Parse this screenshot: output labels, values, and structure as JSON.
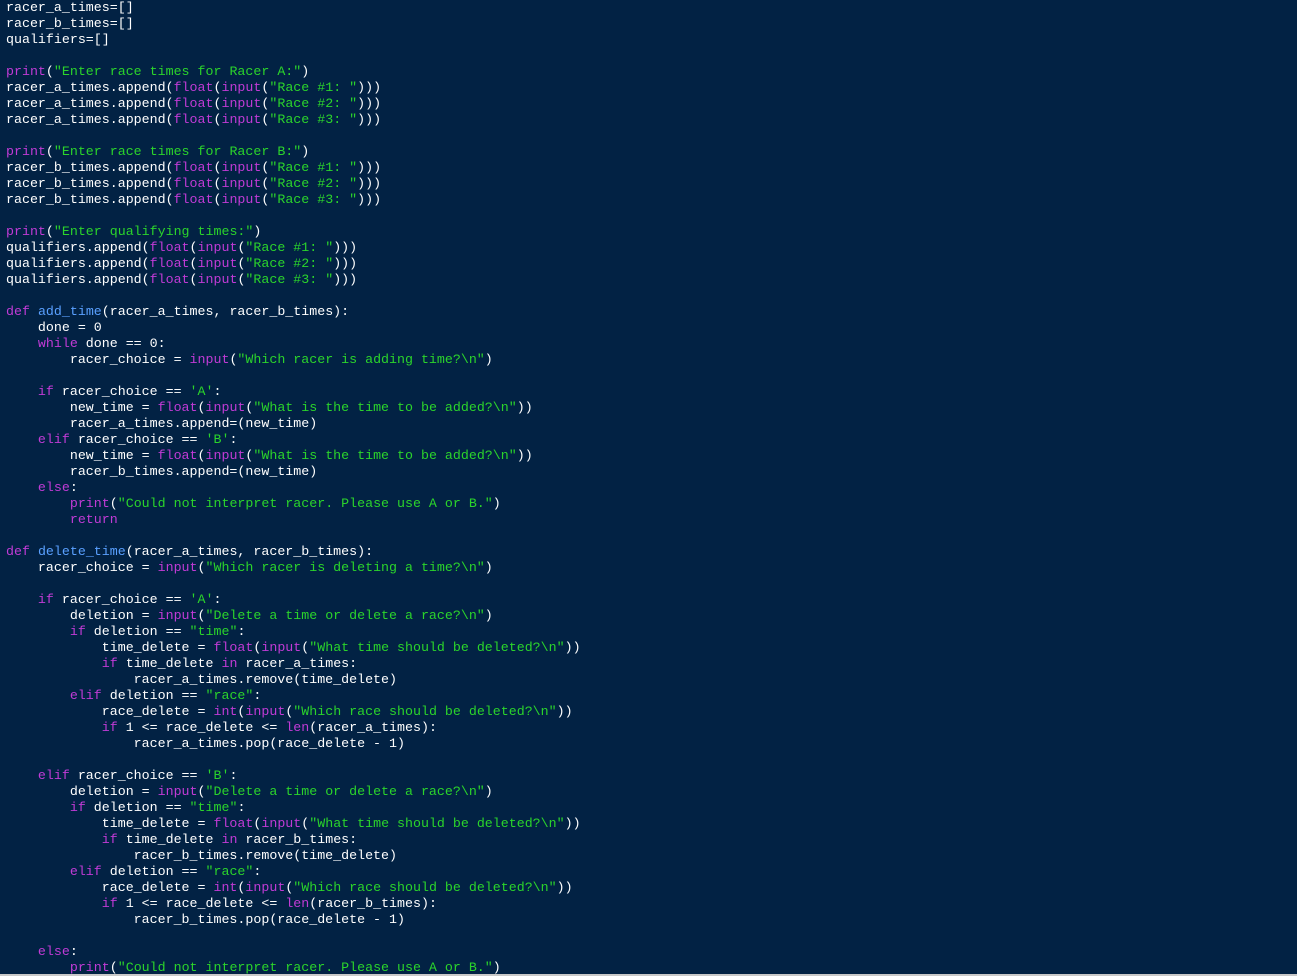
{
  "editor": {
    "colors": {
      "background": "#022244",
      "text": "#ffffff",
      "keyword": "#c13bd6",
      "builtin": "#c13bd6",
      "string": "#2bd42b",
      "function_name": "#5aa0ff"
    },
    "lines": [
      [
        {
          "t": "text",
          "v": "racer_a_times=[]"
        }
      ],
      [
        {
          "t": "text",
          "v": "racer_b_times=[]"
        }
      ],
      [
        {
          "t": "text",
          "v": "qualifiers=[]"
        }
      ],
      [],
      [
        {
          "t": "builtin",
          "v": "print"
        },
        {
          "t": "text",
          "v": "("
        },
        {
          "t": "str",
          "v": "\"Enter race times for Racer A:\""
        },
        {
          "t": "text",
          "v": ")"
        }
      ],
      [
        {
          "t": "text",
          "v": "racer_a_times.append("
        },
        {
          "t": "builtin",
          "v": "float"
        },
        {
          "t": "text",
          "v": "("
        },
        {
          "t": "builtin",
          "v": "input"
        },
        {
          "t": "text",
          "v": "("
        },
        {
          "t": "str",
          "v": "\"Race #1: \""
        },
        {
          "t": "text",
          "v": ")))"
        }
      ],
      [
        {
          "t": "text",
          "v": "racer_a_times.append("
        },
        {
          "t": "builtin",
          "v": "float"
        },
        {
          "t": "text",
          "v": "("
        },
        {
          "t": "builtin",
          "v": "input"
        },
        {
          "t": "text",
          "v": "("
        },
        {
          "t": "str",
          "v": "\"Race #2: \""
        },
        {
          "t": "text",
          "v": ")))"
        }
      ],
      [
        {
          "t": "text",
          "v": "racer_a_times.append("
        },
        {
          "t": "builtin",
          "v": "float"
        },
        {
          "t": "text",
          "v": "("
        },
        {
          "t": "builtin",
          "v": "input"
        },
        {
          "t": "text",
          "v": "("
        },
        {
          "t": "str",
          "v": "\"Race #3: \""
        },
        {
          "t": "text",
          "v": ")))"
        }
      ],
      [],
      [
        {
          "t": "builtin",
          "v": "print"
        },
        {
          "t": "text",
          "v": "("
        },
        {
          "t": "str",
          "v": "\"Enter race times for Racer B:\""
        },
        {
          "t": "text",
          "v": ")"
        }
      ],
      [
        {
          "t": "text",
          "v": "racer_b_times.append("
        },
        {
          "t": "builtin",
          "v": "float"
        },
        {
          "t": "text",
          "v": "("
        },
        {
          "t": "builtin",
          "v": "input"
        },
        {
          "t": "text",
          "v": "("
        },
        {
          "t": "str",
          "v": "\"Race #1: \""
        },
        {
          "t": "text",
          "v": ")))"
        }
      ],
      [
        {
          "t": "text",
          "v": "racer_b_times.append("
        },
        {
          "t": "builtin",
          "v": "float"
        },
        {
          "t": "text",
          "v": "("
        },
        {
          "t": "builtin",
          "v": "input"
        },
        {
          "t": "text",
          "v": "("
        },
        {
          "t": "str",
          "v": "\"Race #2: \""
        },
        {
          "t": "text",
          "v": ")))"
        }
      ],
      [
        {
          "t": "text",
          "v": "racer_b_times.append("
        },
        {
          "t": "builtin",
          "v": "float"
        },
        {
          "t": "text",
          "v": "("
        },
        {
          "t": "builtin",
          "v": "input"
        },
        {
          "t": "text",
          "v": "("
        },
        {
          "t": "str",
          "v": "\"Race #3: \""
        },
        {
          "t": "text",
          "v": ")))"
        }
      ],
      [],
      [
        {
          "t": "builtin",
          "v": "print"
        },
        {
          "t": "text",
          "v": "("
        },
        {
          "t": "str",
          "v": "\"Enter qualifying times:\""
        },
        {
          "t": "text",
          "v": ")"
        }
      ],
      [
        {
          "t": "text",
          "v": "qualifiers.append("
        },
        {
          "t": "builtin",
          "v": "float"
        },
        {
          "t": "text",
          "v": "("
        },
        {
          "t": "builtin",
          "v": "input"
        },
        {
          "t": "text",
          "v": "("
        },
        {
          "t": "str",
          "v": "\"Race #1: \""
        },
        {
          "t": "text",
          "v": ")))"
        }
      ],
      [
        {
          "t": "text",
          "v": "qualifiers.append("
        },
        {
          "t": "builtin",
          "v": "float"
        },
        {
          "t": "text",
          "v": "("
        },
        {
          "t": "builtin",
          "v": "input"
        },
        {
          "t": "text",
          "v": "("
        },
        {
          "t": "str",
          "v": "\"Race #2: \""
        },
        {
          "t": "text",
          "v": ")))"
        }
      ],
      [
        {
          "t": "text",
          "v": "qualifiers.append("
        },
        {
          "t": "builtin",
          "v": "float"
        },
        {
          "t": "text",
          "v": "("
        },
        {
          "t": "builtin",
          "v": "input"
        },
        {
          "t": "text",
          "v": "("
        },
        {
          "t": "str",
          "v": "\"Race #3: \""
        },
        {
          "t": "text",
          "v": ")))"
        }
      ],
      [],
      [
        {
          "t": "kw",
          "v": "def"
        },
        {
          "t": "text",
          "v": " "
        },
        {
          "t": "fn",
          "v": "add_time"
        },
        {
          "t": "text",
          "v": "(racer_a_times, racer_b_times):"
        }
      ],
      [
        {
          "t": "text",
          "v": "    done = 0"
        }
      ],
      [
        {
          "t": "text",
          "v": "    "
        },
        {
          "t": "kw",
          "v": "while"
        },
        {
          "t": "text",
          "v": " done == 0:"
        }
      ],
      [
        {
          "t": "text",
          "v": "        racer_choice = "
        },
        {
          "t": "builtin",
          "v": "input"
        },
        {
          "t": "text",
          "v": "("
        },
        {
          "t": "str",
          "v": "\"Which racer is adding time?\\n\""
        },
        {
          "t": "text",
          "v": ")"
        }
      ],
      [],
      [
        {
          "t": "text",
          "v": "    "
        },
        {
          "t": "kw",
          "v": "if"
        },
        {
          "t": "text",
          "v": " racer_choice == "
        },
        {
          "t": "str",
          "v": "'A'"
        },
        {
          "t": "text",
          "v": ":"
        }
      ],
      [
        {
          "t": "text",
          "v": "        new_time = "
        },
        {
          "t": "builtin",
          "v": "float"
        },
        {
          "t": "text",
          "v": "("
        },
        {
          "t": "builtin",
          "v": "input"
        },
        {
          "t": "text",
          "v": "("
        },
        {
          "t": "str",
          "v": "\"What is the time to be added?\\n\""
        },
        {
          "t": "text",
          "v": "))"
        }
      ],
      [
        {
          "t": "text",
          "v": "        racer_a_times.append=(new_time)"
        }
      ],
      [
        {
          "t": "text",
          "v": "    "
        },
        {
          "t": "kw",
          "v": "elif"
        },
        {
          "t": "text",
          "v": " racer_choice == "
        },
        {
          "t": "str",
          "v": "'B'"
        },
        {
          "t": "text",
          "v": ":"
        }
      ],
      [
        {
          "t": "text",
          "v": "        new_time = "
        },
        {
          "t": "builtin",
          "v": "float"
        },
        {
          "t": "text",
          "v": "("
        },
        {
          "t": "builtin",
          "v": "input"
        },
        {
          "t": "text",
          "v": "("
        },
        {
          "t": "str",
          "v": "\"What is the time to be added?\\n\""
        },
        {
          "t": "text",
          "v": "))"
        }
      ],
      [
        {
          "t": "text",
          "v": "        racer_b_times.append=(new_time)"
        }
      ],
      [
        {
          "t": "text",
          "v": "    "
        },
        {
          "t": "kw",
          "v": "else"
        },
        {
          "t": "text",
          "v": ":"
        }
      ],
      [
        {
          "t": "text",
          "v": "        "
        },
        {
          "t": "builtin",
          "v": "print"
        },
        {
          "t": "text",
          "v": "("
        },
        {
          "t": "str",
          "v": "\"Could not interpret racer. Please use A or B.\""
        },
        {
          "t": "text",
          "v": ")"
        }
      ],
      [
        {
          "t": "text",
          "v": "        "
        },
        {
          "t": "kw",
          "v": "return"
        }
      ],
      [],
      [
        {
          "t": "kw",
          "v": "def"
        },
        {
          "t": "text",
          "v": " "
        },
        {
          "t": "fn",
          "v": "delete_time"
        },
        {
          "t": "text",
          "v": "(racer_a_times, racer_b_times):"
        }
      ],
      [
        {
          "t": "text",
          "v": "    racer_choice = "
        },
        {
          "t": "builtin",
          "v": "input"
        },
        {
          "t": "text",
          "v": "("
        },
        {
          "t": "str",
          "v": "\"Which racer is deleting a time?\\n\""
        },
        {
          "t": "text",
          "v": ")"
        }
      ],
      [],
      [
        {
          "t": "text",
          "v": "    "
        },
        {
          "t": "kw",
          "v": "if"
        },
        {
          "t": "text",
          "v": " racer_choice == "
        },
        {
          "t": "str",
          "v": "'A'"
        },
        {
          "t": "text",
          "v": ":"
        }
      ],
      [
        {
          "t": "text",
          "v": "        deletion = "
        },
        {
          "t": "builtin",
          "v": "input"
        },
        {
          "t": "text",
          "v": "("
        },
        {
          "t": "str",
          "v": "\"Delete a time or delete a race?\\n\""
        },
        {
          "t": "text",
          "v": ")"
        }
      ],
      [
        {
          "t": "text",
          "v": "        "
        },
        {
          "t": "kw",
          "v": "if"
        },
        {
          "t": "text",
          "v": " deletion == "
        },
        {
          "t": "str",
          "v": "\"time\""
        },
        {
          "t": "text",
          "v": ":"
        }
      ],
      [
        {
          "t": "text",
          "v": "            time_delete = "
        },
        {
          "t": "builtin",
          "v": "float"
        },
        {
          "t": "text",
          "v": "("
        },
        {
          "t": "builtin",
          "v": "input"
        },
        {
          "t": "text",
          "v": "("
        },
        {
          "t": "str",
          "v": "\"What time should be deleted?\\n\""
        },
        {
          "t": "text",
          "v": "))"
        }
      ],
      [
        {
          "t": "text",
          "v": "            "
        },
        {
          "t": "kw",
          "v": "if"
        },
        {
          "t": "text",
          "v": " time_delete "
        },
        {
          "t": "kw",
          "v": "in"
        },
        {
          "t": "text",
          "v": " racer_a_times:"
        }
      ],
      [
        {
          "t": "text",
          "v": "                racer_a_times.remove(time_delete)"
        }
      ],
      [
        {
          "t": "text",
          "v": "        "
        },
        {
          "t": "kw",
          "v": "elif"
        },
        {
          "t": "text",
          "v": " deletion == "
        },
        {
          "t": "str",
          "v": "\"race\""
        },
        {
          "t": "text",
          "v": ":"
        }
      ],
      [
        {
          "t": "text",
          "v": "            race_delete = "
        },
        {
          "t": "builtin",
          "v": "int"
        },
        {
          "t": "text",
          "v": "("
        },
        {
          "t": "builtin",
          "v": "input"
        },
        {
          "t": "text",
          "v": "("
        },
        {
          "t": "str",
          "v": "\"Which race should be deleted?\\n\""
        },
        {
          "t": "text",
          "v": "))"
        }
      ],
      [
        {
          "t": "text",
          "v": "            "
        },
        {
          "t": "kw",
          "v": "if"
        },
        {
          "t": "text",
          "v": " 1 <= race_delete <= "
        },
        {
          "t": "builtin",
          "v": "len"
        },
        {
          "t": "text",
          "v": "(racer_a_times):"
        }
      ],
      [
        {
          "t": "text",
          "v": "                racer_a_times.pop(race_delete - 1)"
        }
      ],
      [],
      [
        {
          "t": "text",
          "v": "    "
        },
        {
          "t": "kw",
          "v": "elif"
        },
        {
          "t": "text",
          "v": " racer_choice == "
        },
        {
          "t": "str",
          "v": "'B'"
        },
        {
          "t": "text",
          "v": ":"
        }
      ],
      [
        {
          "t": "text",
          "v": "        deletion = "
        },
        {
          "t": "builtin",
          "v": "input"
        },
        {
          "t": "text",
          "v": "("
        },
        {
          "t": "str",
          "v": "\"Delete a time or delete a race?\\n\""
        },
        {
          "t": "text",
          "v": ")"
        }
      ],
      [
        {
          "t": "text",
          "v": "        "
        },
        {
          "t": "kw",
          "v": "if"
        },
        {
          "t": "text",
          "v": " deletion == "
        },
        {
          "t": "str",
          "v": "\"time\""
        },
        {
          "t": "text",
          "v": ":"
        }
      ],
      [
        {
          "t": "text",
          "v": "            time_delete = "
        },
        {
          "t": "builtin",
          "v": "float"
        },
        {
          "t": "text",
          "v": "("
        },
        {
          "t": "builtin",
          "v": "input"
        },
        {
          "t": "text",
          "v": "("
        },
        {
          "t": "str",
          "v": "\"What time should be deleted?\\n\""
        },
        {
          "t": "text",
          "v": "))"
        }
      ],
      [
        {
          "t": "text",
          "v": "            "
        },
        {
          "t": "kw",
          "v": "if"
        },
        {
          "t": "text",
          "v": " time_delete "
        },
        {
          "t": "kw",
          "v": "in"
        },
        {
          "t": "text",
          "v": " racer_b_times:"
        }
      ],
      [
        {
          "t": "text",
          "v": "                racer_b_times.remove(time_delete)"
        }
      ],
      [
        {
          "t": "text",
          "v": "        "
        },
        {
          "t": "kw",
          "v": "elif"
        },
        {
          "t": "text",
          "v": " deletion == "
        },
        {
          "t": "str",
          "v": "\"race\""
        },
        {
          "t": "text",
          "v": ":"
        }
      ],
      [
        {
          "t": "text",
          "v": "            race_delete = "
        },
        {
          "t": "builtin",
          "v": "int"
        },
        {
          "t": "text",
          "v": "("
        },
        {
          "t": "builtin",
          "v": "input"
        },
        {
          "t": "text",
          "v": "("
        },
        {
          "t": "str",
          "v": "\"Which race should be deleted?\\n\""
        },
        {
          "t": "text",
          "v": "))"
        }
      ],
      [
        {
          "t": "text",
          "v": "            "
        },
        {
          "t": "kw",
          "v": "if"
        },
        {
          "t": "text",
          "v": " 1 <= race_delete <= "
        },
        {
          "t": "builtin",
          "v": "len"
        },
        {
          "t": "text",
          "v": "(racer_b_times):"
        }
      ],
      [
        {
          "t": "text",
          "v": "                racer_b_times.pop(race_delete - 1)"
        }
      ],
      [],
      [
        {
          "t": "text",
          "v": "    "
        },
        {
          "t": "kw",
          "v": "else"
        },
        {
          "t": "text",
          "v": ":"
        }
      ],
      [
        {
          "t": "text",
          "v": "        "
        },
        {
          "t": "builtin",
          "v": "print"
        },
        {
          "t": "text",
          "v": "("
        },
        {
          "t": "str",
          "v": "\"Could not interpret racer. Please use A or B.\""
        },
        {
          "t": "text",
          "v": ")"
        }
      ]
    ]
  }
}
